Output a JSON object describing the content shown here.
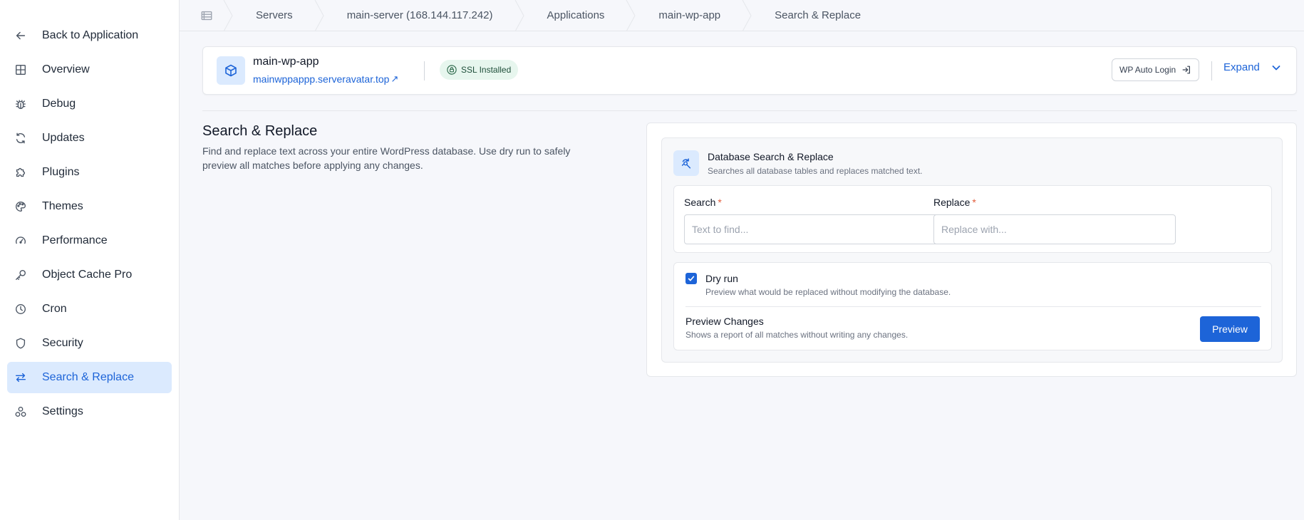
{
  "sidebar": {
    "items": [
      {
        "label": "Back to Application",
        "icon": "arrow-left-icon"
      },
      {
        "label": "Overview",
        "icon": "grid-icon"
      },
      {
        "label": "Debug",
        "icon": "bug-icon"
      },
      {
        "label": "Updates",
        "icon": "refresh-icon"
      },
      {
        "label": "Plugins",
        "icon": "puzzle-icon"
      },
      {
        "label": "Themes",
        "icon": "palette-icon"
      },
      {
        "label": "Performance",
        "icon": "gauge-icon"
      },
      {
        "label": "Object Cache Pro",
        "icon": "key-icon"
      },
      {
        "label": "Cron",
        "icon": "clock-icon"
      },
      {
        "label": "Security",
        "icon": "shield-icon"
      },
      {
        "label": "Search & Replace",
        "icon": "swap-icon",
        "active": true
      },
      {
        "label": "Settings",
        "icon": "settings-icon"
      }
    ]
  },
  "breadcrumb": {
    "home_icon": "server-list-icon",
    "items": [
      "Servers",
      "main-server (168.144.117.242)",
      "Applications",
      "main-wp-app",
      "Search & Replace"
    ]
  },
  "app": {
    "name": "main-wp-app",
    "url": "mainwppappp.serveravatar.top",
    "url_icon": "external-link-icon",
    "ssl_label": "SSL Installed",
    "wp_login_label": "WP Auto Login",
    "expand_label": "Expand"
  },
  "section": {
    "title": "Search & Replace",
    "description": "Find and replace text across your entire WordPress database. Use dry run to safely preview all matches before applying any changes."
  },
  "tool": {
    "title": "Database Search & Replace",
    "subtitle": "Searches all database tables and replaces matched text.",
    "search_label": "Search",
    "search_placeholder": "Text to find...",
    "search_value": "",
    "replace_label": "Replace",
    "replace_placeholder": "Replace with...",
    "replace_value": "",
    "required_mark": "*",
    "dry_run_label": "Dry run",
    "dry_run_checked": true,
    "dry_run_desc": "Preview what would be replaced without modifying the database.",
    "preview_title": "Preview Changes",
    "preview_desc": "Shows a report of all matches without writing any changes.",
    "preview_button": "Preview"
  },
  "colors": {
    "accent": "#1d64d8",
    "accent_soft": "#dbeafe",
    "ssl_bg": "#e7f6ee",
    "required": "#e25c3b"
  }
}
